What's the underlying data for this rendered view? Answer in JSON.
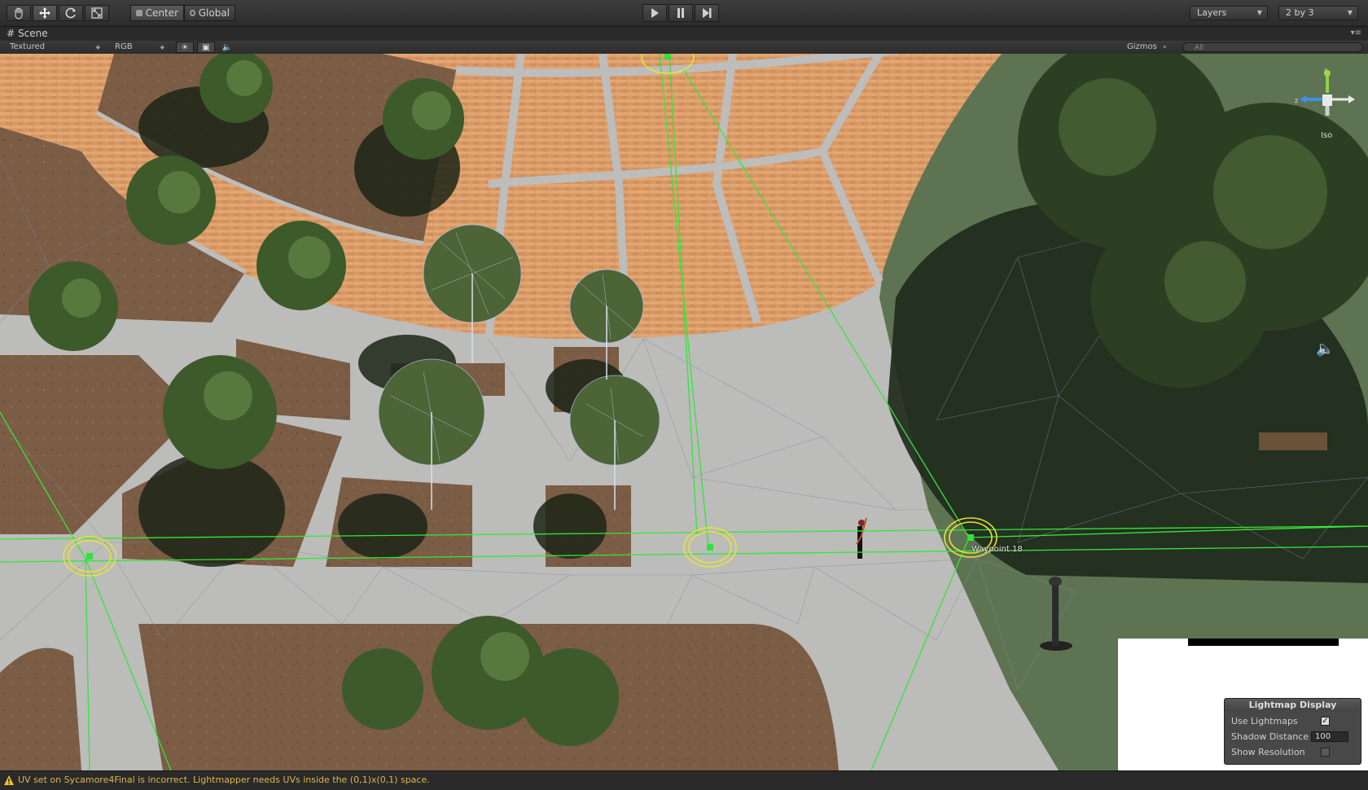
{
  "toolbar": {
    "tools": [
      {
        "icon": "hand-icon"
      },
      {
        "icon": "move-icon"
      },
      {
        "icon": "rotate-icon"
      },
      {
        "icon": "scale-icon"
      }
    ],
    "pivot_mode": "Center",
    "pivot_rotation": "Global",
    "playback": [
      {
        "icon": "play-icon"
      },
      {
        "icon": "pause-icon"
      },
      {
        "icon": "step-icon"
      }
    ],
    "layers_label": "Layers",
    "layout_label": "2 by 3"
  },
  "scene_tab": {
    "label": "Scene"
  },
  "scene_toolbar": {
    "render_mode": "Textured",
    "color_mode": "RGB",
    "gizmos_label": "Gizmos",
    "search_placeholder": "All"
  },
  "viewport": {
    "waypoint_label": "Waypoint 18",
    "projection_label": "Iso",
    "gizmo_axes": [
      "y",
      "z",
      "x"
    ]
  },
  "lightmap_display": {
    "title": "Lightmap Display",
    "use_lightmaps_label": "Use Lightmaps",
    "use_lightmaps": true,
    "shadow_distance_label": "Shadow Distance",
    "shadow_distance": "100",
    "show_resolution_label": "Show Resolution",
    "show_resolution": false
  },
  "status_bar": {
    "message": "UV set on Sycamore4Final is incorrect. Lightmapper needs UVs inside the (0,1)x(0,1) space.",
    "color": "#e0b64a"
  },
  "colors": {
    "navmesh_path": "#35e53a",
    "waypoint_ring": "#e8e23a",
    "brick": "#d99a66",
    "dirt": "#7a5b44",
    "pavement": "#bcbcba",
    "grass": "#5a6e4e"
  }
}
